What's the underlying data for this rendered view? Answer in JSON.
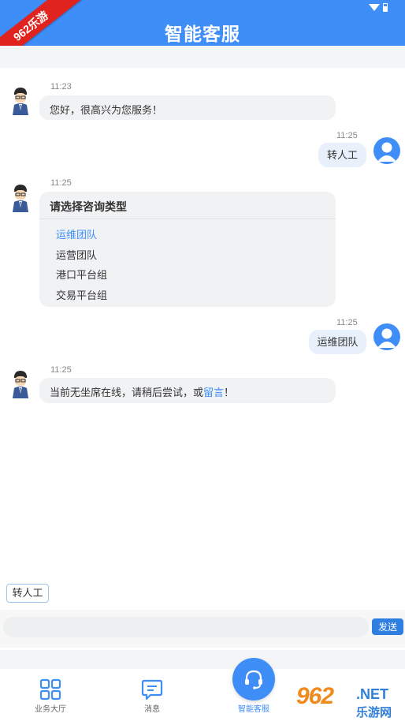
{
  "header": {
    "title": "智能客服"
  },
  "corner_badge": {
    "text": "962乐游"
  },
  "messages": [
    {
      "time": "11:23",
      "text": "您好，很高兴为您服务！"
    },
    {
      "time": "11:25",
      "text": "转人工"
    },
    {
      "time": "11:25",
      "title": "请选择咨询类型",
      "options": [
        "运维团队",
        "运营团队",
        "港口平台组",
        "交易平台组"
      ]
    },
    {
      "time": "11:25",
      "text": "运维团队"
    },
    {
      "time": "11:25",
      "text_before": "当前无坐席在线，请稍后尝试，或",
      "link": "留言",
      "text_after": "！"
    }
  ],
  "quick_reply": {
    "label": "转人工"
  },
  "input": {
    "value": "",
    "placeholder": "",
    "send_label": "发送"
  },
  "tabs": [
    {
      "label": "业务大厅",
      "icon": "grid-icon"
    },
    {
      "label": "消息",
      "icon": "message-icon"
    },
    {
      "label": "智能客服",
      "icon": "headset-icon",
      "active": true
    }
  ],
  "watermark": {
    "brand": "962",
    "net": ".NET",
    "sub": "乐游网"
  },
  "colors": {
    "primary": "#3f8ef7",
    "bubble": "#f1f2f4",
    "my_bubble": "#e8f1fb",
    "badge": "#e0231f"
  }
}
